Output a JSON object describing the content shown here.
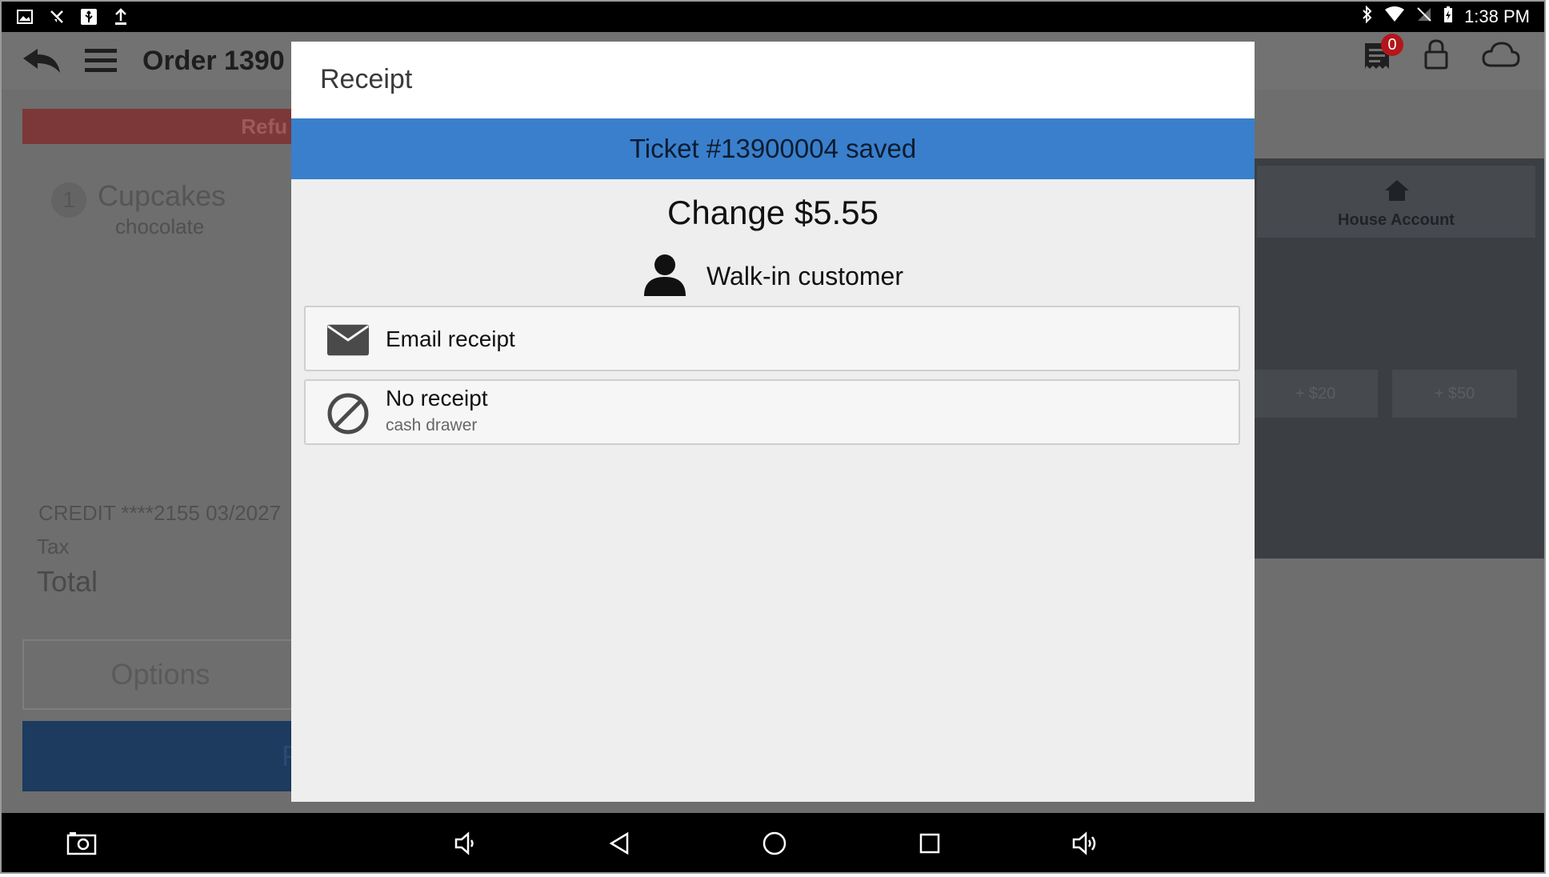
{
  "status_bar": {
    "time": "1:38 PM",
    "left_icons": [
      "image-icon",
      "mute-icon",
      "usb-icon",
      "upload-icon"
    ],
    "right_icons": [
      "bluetooth-icon",
      "wifi-icon",
      "no-signal-icon",
      "battery-charging-icon"
    ]
  },
  "app_bar": {
    "order_title": "Order 1390",
    "notification_count": "0"
  },
  "background": {
    "refund_label": "Refu",
    "line_item": {
      "qty": "1",
      "name": "Cupcakes",
      "variant": "chocolate"
    },
    "payment_line": "CREDIT ****2155 03/2027",
    "tax_label": "Tax",
    "total_label": "Total",
    "options_label": "Options",
    "pay_label": "P",
    "house_account_label": "House Account",
    "cash_buttons": [
      "+ $20",
      "+ $50"
    ]
  },
  "dialog": {
    "title": "Receipt",
    "saved_message": "Ticket #13900004 saved",
    "change_text": "Change $5.55",
    "customer_name": "Walk-in customer",
    "options": [
      {
        "label": "Email receipt",
        "sublabel": "",
        "icon": "envelope-icon"
      },
      {
        "label": "No receipt",
        "sublabel": "cash drawer",
        "icon": "no-entry-icon"
      }
    ]
  },
  "colors": {
    "accent_blue": "#3a7fcc",
    "badge_red": "#b3161b",
    "scrim_gray": "#6e6e6e"
  }
}
